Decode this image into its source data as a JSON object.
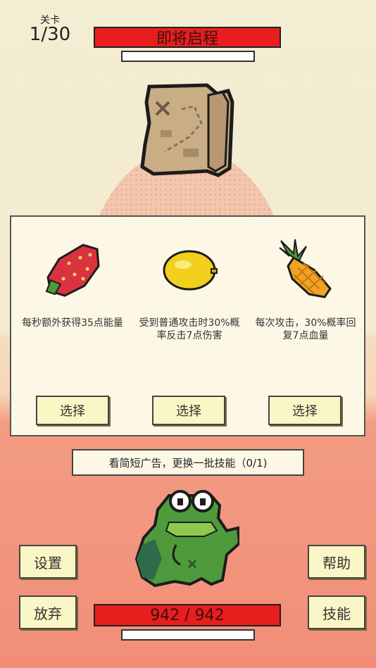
{
  "level": {
    "caption": "关卡",
    "value": "1/30"
  },
  "status_title": "即将启程",
  "skills": [
    {
      "icon": "strawberry-icon",
      "description": "每秒额外获得35点能量",
      "select_label": "选择"
    },
    {
      "icon": "lemon-icon",
      "description": "受到普通攻击时30%概率反击7点伤害",
      "select_label": "选择"
    },
    {
      "icon": "pineapple-icon",
      "description": "每次攻击，30%概率回复7点血量",
      "select_label": "选择"
    }
  ],
  "ad_refresh_label": "看简短广告，更换一批技能（0/1)",
  "buttons": {
    "settings": "设置",
    "help": "帮助",
    "give_up": "放弃",
    "skills": "技能"
  },
  "hp_text": "942 / 942",
  "colors": {
    "bar_red": "#e81e1e",
    "panel": "#fdf8e6",
    "button": "#fbf6c6"
  }
}
